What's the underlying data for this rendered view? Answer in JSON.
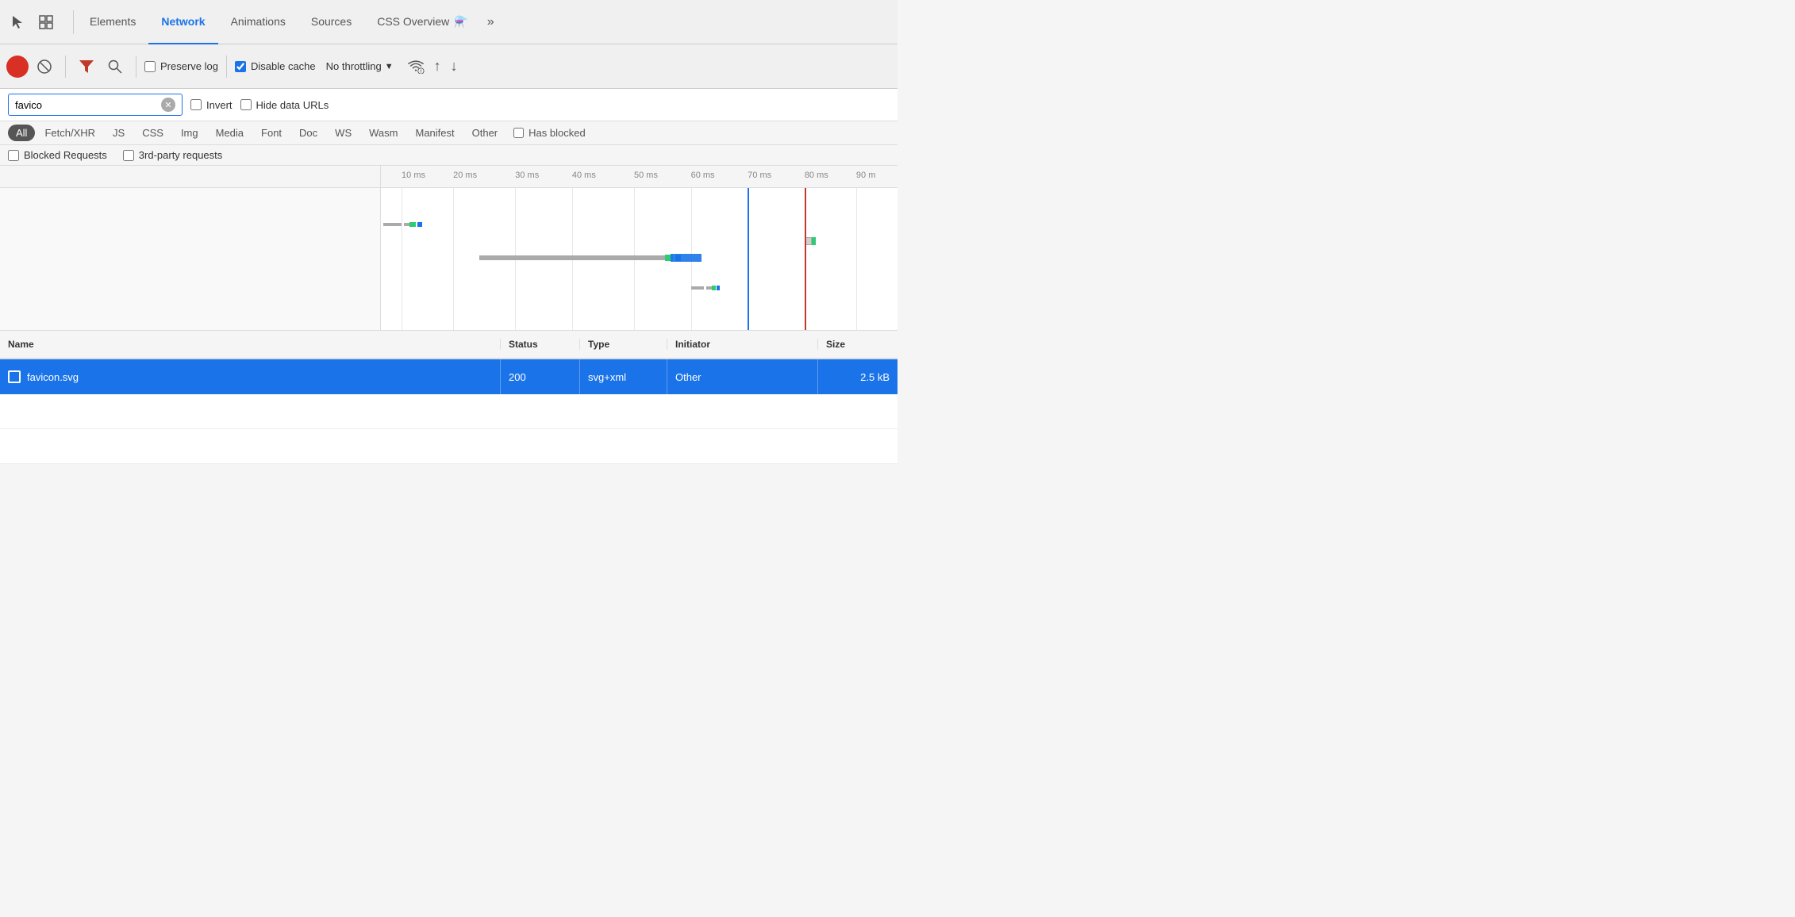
{
  "tabs": {
    "items": [
      {
        "label": "Elements",
        "active": false
      },
      {
        "label": "Network",
        "active": true
      },
      {
        "label": "Animations",
        "active": false
      },
      {
        "label": "Sources",
        "active": false
      },
      {
        "label": "CSS Overview",
        "active": false
      }
    ],
    "more_label": "»"
  },
  "toolbar": {
    "preserve_log_label": "Preserve log",
    "disable_cache_label": "Disable cache",
    "no_throttling_label": "No throttling",
    "preserve_log_checked": false,
    "disable_cache_checked": true
  },
  "filter": {
    "search_value": "favico",
    "invert_label": "Invert",
    "hide_data_urls_label": "Hide data URLs",
    "invert_checked": false,
    "hide_data_urls_checked": false
  },
  "type_filters": {
    "items": [
      "All",
      "Fetch/XHR",
      "JS",
      "CSS",
      "Img",
      "Media",
      "Font",
      "Doc",
      "WS",
      "Wasm",
      "Manifest",
      "Other"
    ],
    "active": "All",
    "has_blocked_label": "Has blocked"
  },
  "blocked": {
    "blocked_requests_label": "Blocked Requests",
    "third_party_label": "3rd-party requests"
  },
  "timeline": {
    "ticks": [
      "10 ms",
      "20 ms",
      "30 ms",
      "40 ms",
      "50 ms",
      "60 ms",
      "70 ms",
      "80 ms",
      "90 m"
    ]
  },
  "table": {
    "columns": {
      "name": "Name",
      "status": "Status",
      "type": "Type",
      "initiator": "Initiator",
      "size": "Size"
    },
    "rows": [
      {
        "name": "favicon.svg",
        "status": "200",
        "type": "svg+xml",
        "initiator": "Other",
        "size": "2.5 kB"
      }
    ]
  }
}
